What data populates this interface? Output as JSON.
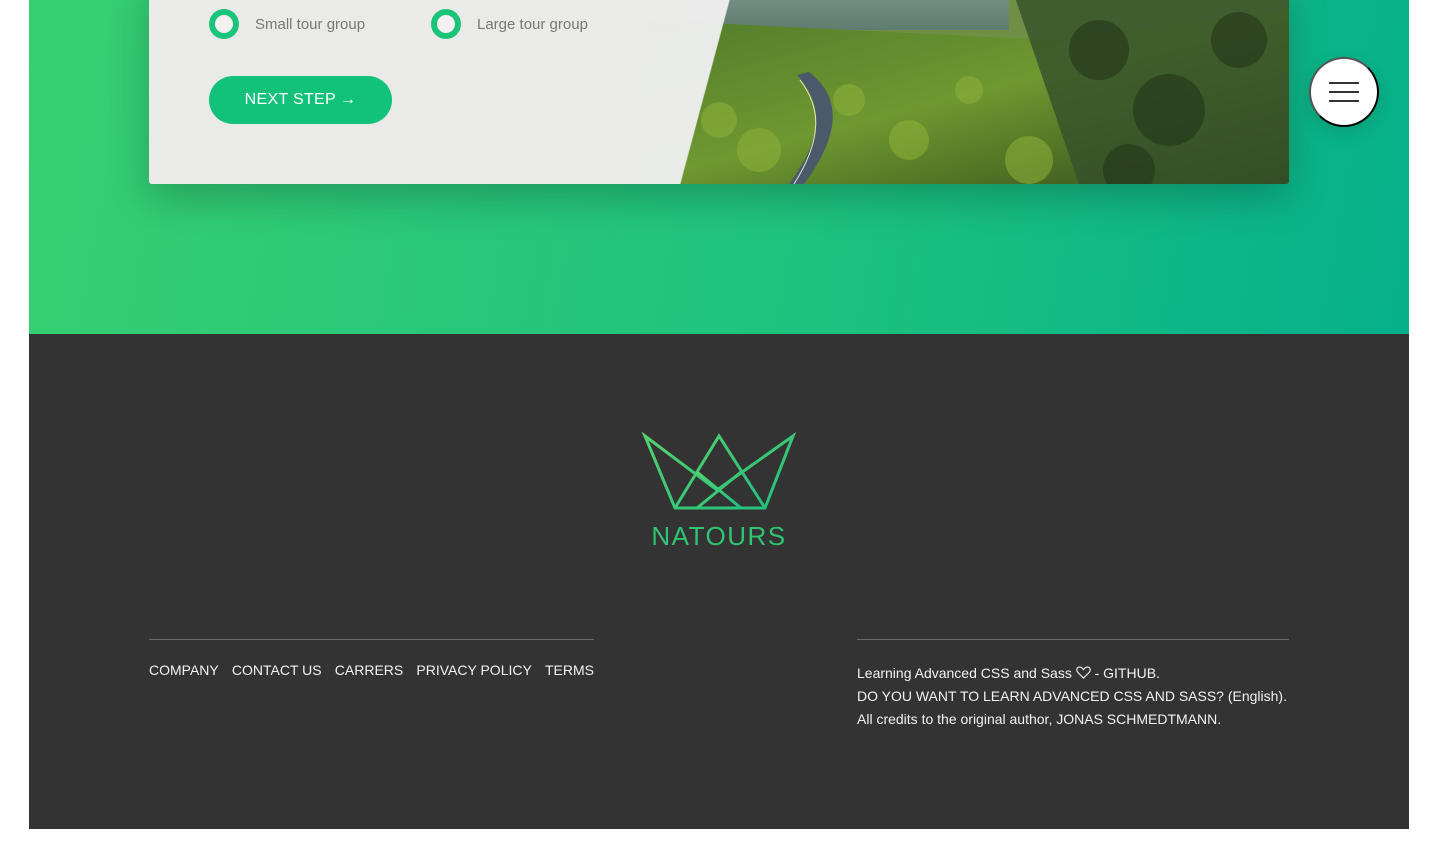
{
  "booking": {
    "options": {
      "small": "Small tour group",
      "large": "Large tour group"
    },
    "next_button": "Next step",
    "next_arrow": "→"
  },
  "menu": {
    "icon": "hamburger-menu-icon"
  },
  "footer": {
    "logo_text": "NATOURS",
    "logo_icon": "crown-logo-icon",
    "nav": [
      "COMPANY",
      "CONTACT US",
      "CARRERS",
      "PRIVACY POLICY",
      "TERMS"
    ],
    "info": {
      "line1_text": "Learning Advanced CSS and Sass",
      "line1_separator": " - ",
      "github_link": "GITHUB.",
      "line2_link": "DO YOU WANT TO LEARN ADVANCED CSS AND SASS? (English).",
      "line2_rest": " All credits to the original author, ",
      "author_link": "JONAS SCHMEDTMANN."
    }
  },
  "colors": {
    "green_primary": "#12c27a",
    "green_light": "#37cf72",
    "green_dark": "#06b08a",
    "footer_bg": "#333333",
    "text_light": "#f2f2f2"
  }
}
